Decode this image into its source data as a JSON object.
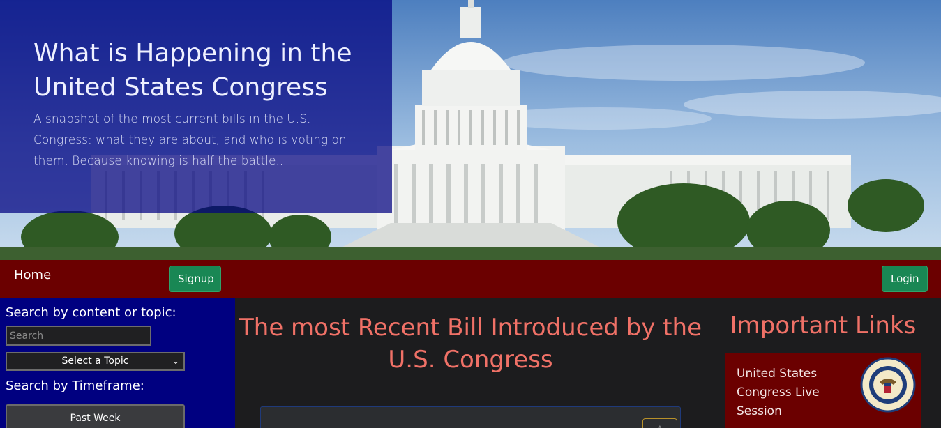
{
  "hero": {
    "title": "What is Happening in the United States Congress",
    "subtitle": "A snapshot of the most current bills in the U.S. Congress: what they are about, and who is voting on them. Because knowing is half the battle.."
  },
  "nav": {
    "home_label": "Home",
    "signup_label": "Signup",
    "login_label": "Login"
  },
  "sidebar": {
    "search_label": "Search by content or topic:",
    "search_placeholder": "Search",
    "topic_select": "Select a Topic",
    "timeframe_label": "Search by Timeframe:",
    "timeframe_button": "Past Week"
  },
  "main": {
    "title": "The most Recent Bill Introduced by the U.S. Congress"
  },
  "links": {
    "title": "Important Links",
    "items": [
      {
        "label": "United States Congress Live Session",
        "icon": "house-seal-icon"
      }
    ]
  },
  "colors": {
    "navbar": "#6b0000",
    "sidebar": "#000080",
    "accent_title": "#f07167",
    "button_green": "#198754"
  }
}
